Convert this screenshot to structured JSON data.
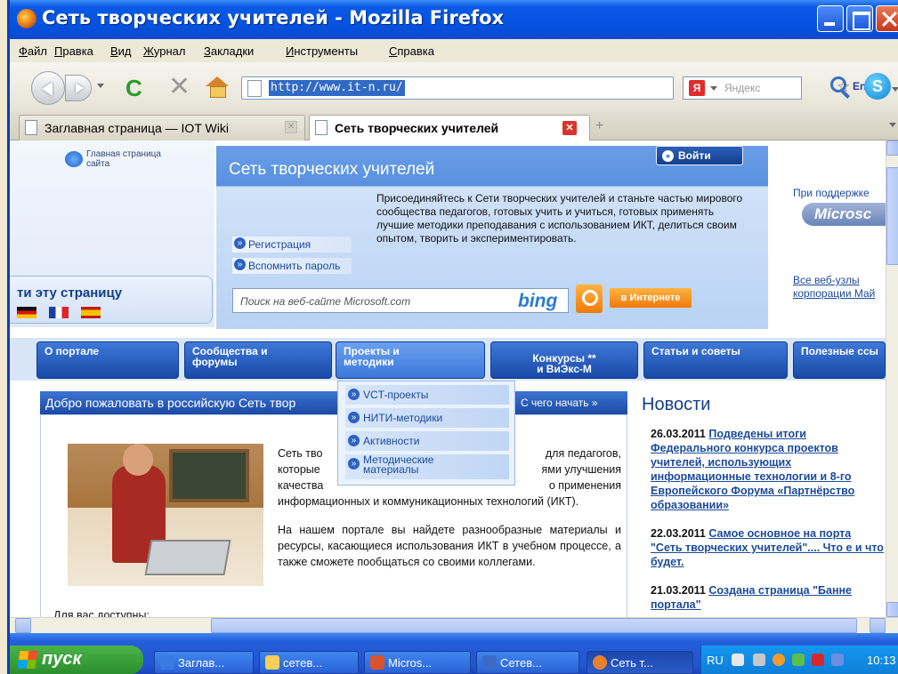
{
  "window": {
    "title": "Сеть творческих учителей - Mozilla Firefox"
  },
  "menu": [
    "Файл",
    "Правка",
    "Вид",
    "Журнал",
    "Закладки",
    "Инструменты",
    "Справка"
  ],
  "address": {
    "url": "http://www.it-n.ru/",
    "lang_badge": "En",
    "search_engine_placeholder": "Яндекс",
    "search_engine_logo": "Я"
  },
  "tabs": [
    {
      "label": "Заглавная страница — IOT Wiki",
      "active": false
    },
    {
      "label": "Сеть творческих учителей",
      "active": true
    }
  ],
  "page": {
    "home_link": "Главная страница сайта",
    "banner_title": "Сеть творческих учителей",
    "login_label": "Войти",
    "join_text": "Присоединяйтесь к Сети творческих учителей и станьте частью мирового сообщества педагогов, готовых учить и учиться, готовых применять лучшие методики преподавания с использованием ИКТ, делиться своим опытом, творить и экспериментировать.",
    "register_link": "Регистрация",
    "remember_link": "Вспомнить пароль",
    "lang_title": "ти эту страницу",
    "search_placeholder": "Поиск на веб-сайте Microsoft.com",
    "bing": "bing",
    "internet_btn": "в Интернете",
    "support": "При поддержке",
    "ms_badge": "Microsc",
    "ms_links_1": "Все веб-узлы",
    "ms_links_2": "корпорации Май"
  },
  "nav_tabs": [
    {
      "label": "О портале"
    },
    {
      "label": "Сообщества и\nфорумы"
    },
    {
      "label": "Проекты и\nметодики"
    },
    {
      "label": "Конкурсы **\nи ВиЭкс-М"
    },
    {
      "label": "Статьи и советы"
    },
    {
      "label": "Полезные ссы"
    }
  ],
  "dropdown": [
    "VCT-проекты",
    "НИТИ-методики",
    "Активности",
    "Методические\nматериалы"
  ],
  "welcome": {
    "bar_text": "Добро пожаловать в российскую Сеть твор",
    "start_link": "С чего начать",
    "p1_a": "Сеть  тво",
    "p1_b": "для  педагогов,",
    "p1_c": "которые",
    "p1_d": "ями    улучшения",
    "p1_e": "качества",
    "p1_f": "о        применения",
    "p1_g": "информационных и коммуникационных технологий (ИКТ).",
    "p2": "На нашем портале вы найдете разнообразные материалы и ресурсы, касающиеся использования ИКТ в учебном процессе, а также сможете пообщаться со своими коллегами.",
    "available": "Для вас доступны:"
  },
  "news": {
    "title": "Новости",
    "items": [
      {
        "date": "26.03.2011",
        "text": "Подведены итоги Федерального конкурса проектов учителей, использующих информационные технологии и 8-го Европейского Форума «Партнёрство образовании»"
      },
      {
        "date": "22.03.2011",
        "text": "Самое основное на порта \"Сеть творческих учителей\".... Что е и что будет."
      },
      {
        "date": "21.03.2011",
        "text": "Создана страница \"Банне портала\""
      }
    ]
  },
  "taskbar": {
    "start": "пуск",
    "tasks": [
      {
        "label": "Заглав...",
        "icon": "ie-icon",
        "color": "#3a7ae0"
      },
      {
        "label": "сетев...",
        "icon": "folder-icon",
        "color": "#f5cf5a"
      },
      {
        "label": "Micros...",
        "icon": "powerpoint-icon",
        "color": "#d9542d"
      },
      {
        "label": "Сетев...",
        "icon": "word-icon",
        "color": "#3c6bc7"
      },
      {
        "label": "Сеть т...",
        "icon": "firefox-icon",
        "color": "#e8822a"
      }
    ],
    "tray_lang": "RU",
    "clock": "10:13"
  }
}
